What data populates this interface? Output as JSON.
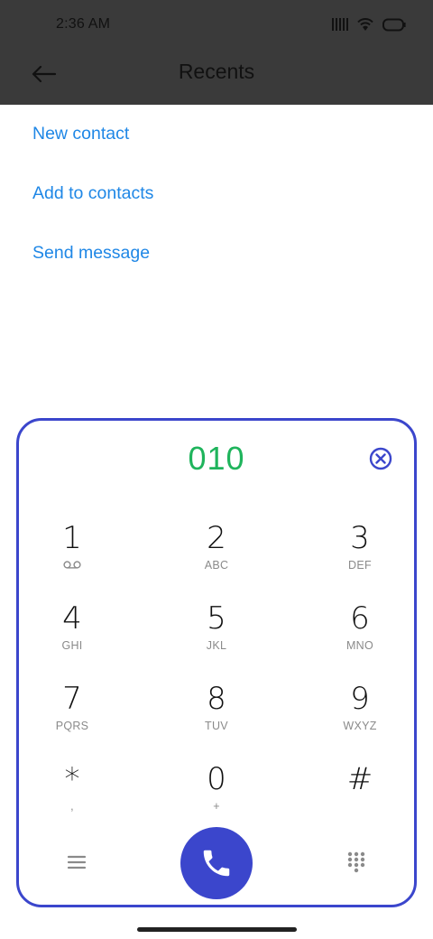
{
  "status_bar": {
    "time": "2:36 AM",
    "icons": [
      "signal-icon",
      "wifi-icon",
      "battery-icon"
    ]
  },
  "header": {
    "title": "Recents",
    "back_icon": "arrow-left-icon"
  },
  "actions": {
    "new_contact": "New contact",
    "add_to_contacts": "Add to contacts",
    "send_message": "Send message"
  },
  "dialpad": {
    "number": "010",
    "clear_icon": "clear-circle-icon",
    "keys": [
      {
        "digit": "1",
        "letters": "",
        "sub_icon": "voicemail-icon"
      },
      {
        "digit": "2",
        "letters": "ABC"
      },
      {
        "digit": "3",
        "letters": "DEF"
      },
      {
        "digit": "4",
        "letters": "GHI"
      },
      {
        "digit": "5",
        "letters": "JKL"
      },
      {
        "digit": "6",
        "letters": "MNO"
      },
      {
        "digit": "7",
        "letters": "PQRS"
      },
      {
        "digit": "8",
        "letters": "TUV"
      },
      {
        "digit": "9",
        "letters": "WXYZ"
      },
      {
        "digit": "*",
        "letters": ","
      },
      {
        "digit": "0",
        "letters": "+"
      },
      {
        "digit": "#",
        "letters": ""
      }
    ],
    "bottom": {
      "menu_icon": "menu-icon",
      "call_icon": "phone-icon",
      "keypad_icon": "keypad-grid-icon"
    }
  },
  "colors": {
    "header_bg": "#3a3a3a",
    "link": "#1f87e6",
    "number": "#1fb45c",
    "accent": "#3b46cc"
  }
}
